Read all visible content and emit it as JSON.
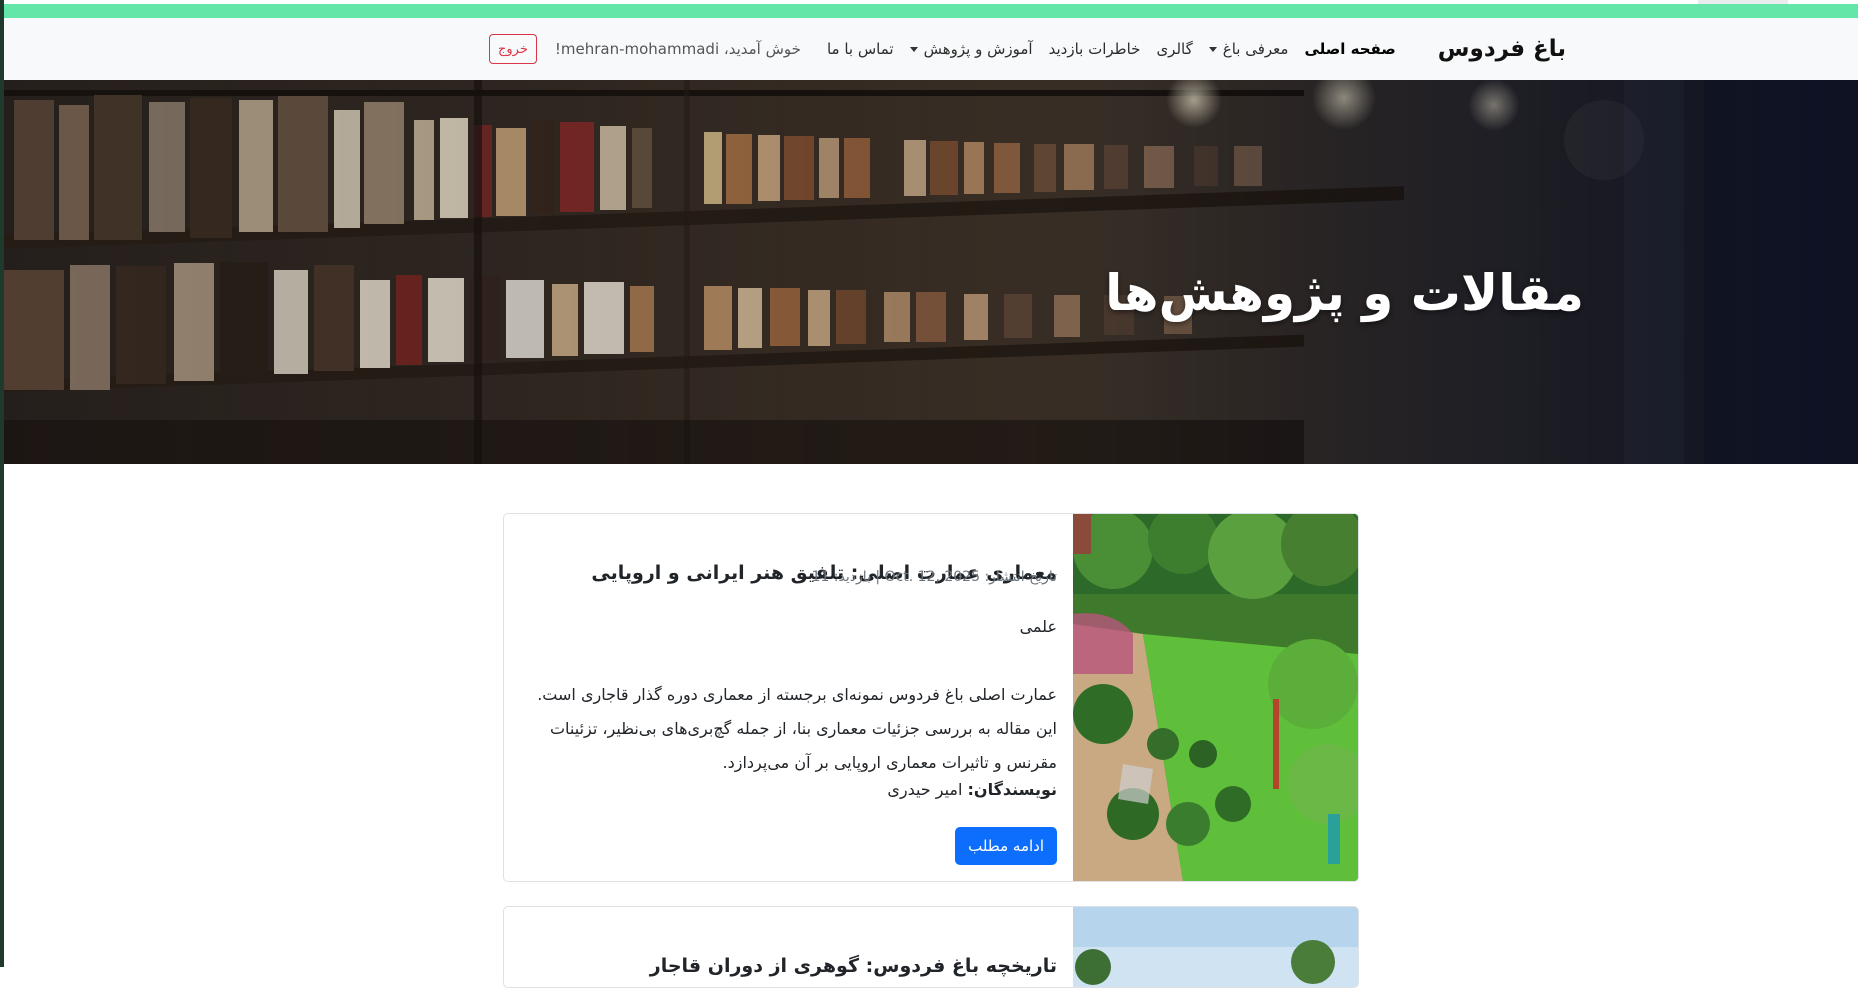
{
  "nav": {
    "brand": "باغ فردوس",
    "items": [
      {
        "label": "صفحه اصلی",
        "active": true,
        "dropdown": false
      },
      {
        "label": "معرفی باغ",
        "active": false,
        "dropdown": true
      },
      {
        "label": "گالری",
        "active": false,
        "dropdown": false
      },
      {
        "label": "خاطرات بازدید",
        "active": false,
        "dropdown": false
      },
      {
        "label": "آموزش و پژوهش",
        "active": false,
        "dropdown": true
      },
      {
        "label": "تماس با ما",
        "active": false,
        "dropdown": false
      }
    ],
    "welcome": "خوش آمدید، mehran-mohammadi!",
    "logout_label": "خروج"
  },
  "hero": {
    "title": "مقالات و پژوهش‌ها"
  },
  "articles": [
    {
      "title": "معماری عمارت اصلی: تلفیق هنر ایرانی و اروپایی",
      "meta": "تاریخ انتشار: Oct. 12, 2025 | بازدید: 11",
      "category": "علمی",
      "text": "عمارت اصلی باغ فردوس نمونه‌ای برجسته از معماری دوره گذار قاجاری است. این مقاله به بررسی جزئیات معماری بنا، از جمله گچ‌بری‌های بی‌نظیر، تزئینات مقرنس و تاثیرات معماری اروپایی بر آن می‌پردازد.",
      "authors_label": "نویسندگان:",
      "authors": "امیر حیدری",
      "button": "ادامه مطلب"
    },
    {
      "title": "تاریخچه باغ فردوس: گوهری از دوران قاجار"
    }
  ],
  "colors": {
    "accent_strip": "#63e6a7",
    "primary_button": "#0d6efd",
    "logout": "#dc3545"
  }
}
